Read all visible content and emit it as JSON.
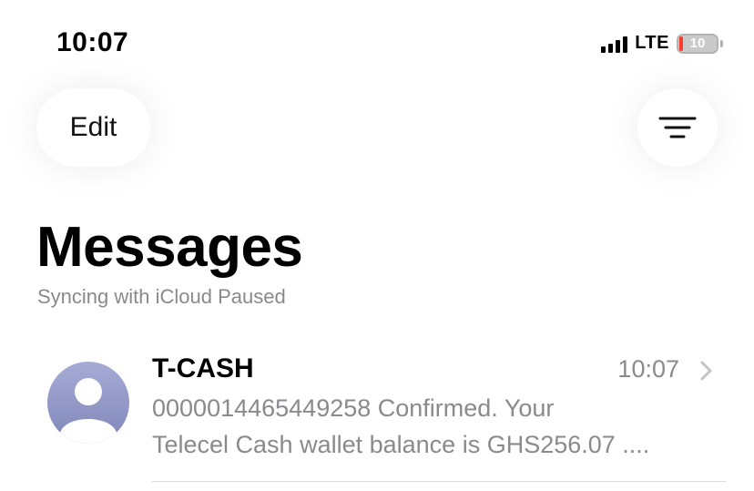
{
  "status_bar": {
    "time": "10:07",
    "network": "LTE",
    "battery": "10"
  },
  "toolbar": {
    "edit_label": "Edit"
  },
  "header": {
    "title": "Messages",
    "sync_status": "Syncing with iCloud Paused"
  },
  "conversations": [
    {
      "sender": "T-CASH",
      "time": "10:07",
      "preview_line1": "0000014465449258 Confirmed. Your",
      "preview_line2": "Telecel Cash wallet balance is  GHS256.07 ...."
    }
  ],
  "colors": {
    "secondary_text": "#8a8a8e",
    "battery_low": "#ff3b30",
    "avatar_top": "#a7abd6",
    "avatar_bottom": "#7f86b8"
  }
}
